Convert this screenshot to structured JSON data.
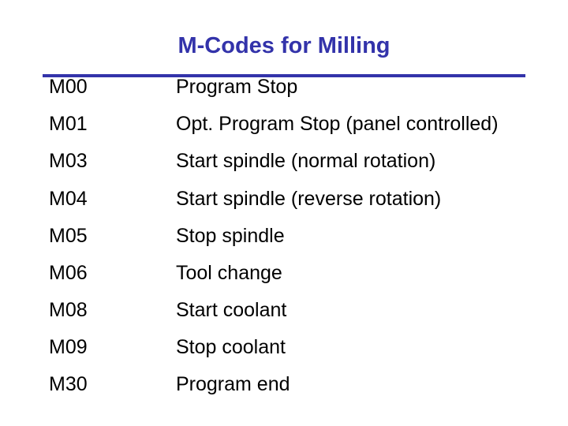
{
  "slide": {
    "title": "M-Codes for Milling",
    "accent_color": "#3333aa",
    "rows": [
      {
        "code": "M00",
        "description": "Program Stop"
      },
      {
        "code": "M01",
        "description": "Opt. Program Stop (panel controlled)"
      },
      {
        "code": "M03",
        "description": "Start spindle (normal rotation)"
      },
      {
        "code": "M04",
        "description": "Start spindle (reverse rotation)"
      },
      {
        "code": "M05",
        "description": "Stop spindle"
      },
      {
        "code": "M06",
        "description": "Tool change"
      },
      {
        "code": "M08",
        "description": "Start coolant"
      },
      {
        "code": "M09",
        "description": "Stop coolant"
      },
      {
        "code": "M30",
        "description": "Program end"
      }
    ]
  }
}
